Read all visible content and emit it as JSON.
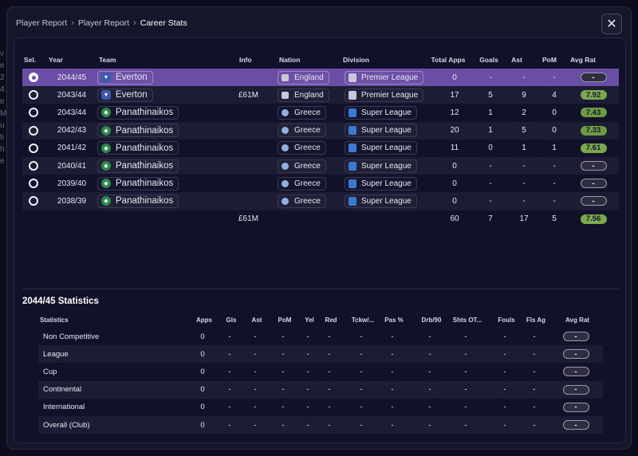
{
  "breadcrumb": [
    "Player Report",
    "Player Report",
    "Career Stats"
  ],
  "close_glyph": "✕",
  "bg_fragment": [
    "v",
    "e",
    "",
    "",
    "",
    "2",
    "4",
    "",
    "e",
    "M",
    "u",
    "ti",
    "h",
    "e"
  ],
  "career": {
    "headers": {
      "sel": "Sel.",
      "year": "Year",
      "team": "Team",
      "info": "Info",
      "nation": "Nation",
      "division": "Division",
      "apps": "Total Apps",
      "goals": "Goals",
      "ast": "Ast",
      "pom": "PoM",
      "avg": "Avg Rat"
    },
    "rows": [
      {
        "selected": true,
        "year": "2044/45",
        "team": "Everton",
        "team_icon": "everton-crest-icon",
        "info": "",
        "nation": "England",
        "nation_icon": "england-flag-icon",
        "division": "Premier League",
        "division_icon": "premier-league-icon",
        "apps": "0",
        "goals": "-",
        "ast": "-",
        "pom": "-",
        "avg": "-"
      },
      {
        "selected": false,
        "year": "2043/44",
        "team": "Everton",
        "team_icon": "everton-crest-icon",
        "info": "£61M",
        "nation": "England",
        "nation_icon": "england-flag-icon",
        "division": "Premier League",
        "division_icon": "premier-league-icon",
        "apps": "17",
        "goals": "5",
        "ast": "9",
        "pom": "4",
        "avg": "7.92"
      },
      {
        "selected": false,
        "year": "2043/44",
        "team": "Panathinaikos",
        "team_icon": "panathinaikos-crest-icon",
        "info": "",
        "nation": "Greece",
        "nation_icon": "greece-flag-icon",
        "division": "Super League",
        "division_icon": "super-league-icon",
        "apps": "12",
        "goals": "1",
        "ast": "2",
        "pom": "0",
        "avg": "7.43"
      },
      {
        "selected": false,
        "year": "2042/43",
        "team": "Panathinaikos",
        "team_icon": "panathinaikos-crest-icon",
        "info": "",
        "nation": "Greece",
        "nation_icon": "greece-flag-icon",
        "division": "Super League",
        "division_icon": "super-league-icon",
        "apps": "20",
        "goals": "1",
        "ast": "5",
        "pom": "0",
        "avg": "7.33"
      },
      {
        "selected": false,
        "year": "2041/42",
        "team": "Panathinaikos",
        "team_icon": "panathinaikos-crest-icon",
        "info": "",
        "nation": "Greece",
        "nation_icon": "greece-flag-icon",
        "division": "Super League",
        "division_icon": "super-league-icon",
        "apps": "11",
        "goals": "0",
        "ast": "1",
        "pom": "1",
        "avg": "7.61"
      },
      {
        "selected": false,
        "year": "2040/41",
        "team": "Panathinaikos",
        "team_icon": "panathinaikos-crest-icon",
        "info": "",
        "nation": "Greece",
        "nation_icon": "greece-flag-icon",
        "division": "Super League",
        "division_icon": "super-league-icon",
        "apps": "0",
        "goals": "-",
        "ast": "-",
        "pom": "-",
        "avg": "-"
      },
      {
        "selected": false,
        "year": "2039/40",
        "team": "Panathinaikos",
        "team_icon": "panathinaikos-crest-icon",
        "info": "",
        "nation": "Greece",
        "nation_icon": "greece-flag-icon",
        "division": "Super League",
        "division_icon": "super-league-icon",
        "apps": "0",
        "goals": "-",
        "ast": "-",
        "pom": "-",
        "avg": "-"
      },
      {
        "selected": false,
        "year": "2038/39",
        "team": "Panathinaikos",
        "team_icon": "panathinaikos-crest-icon",
        "info": "",
        "nation": "Greece",
        "nation_icon": "greece-flag-icon",
        "division": "Super League",
        "division_icon": "super-league-icon",
        "apps": "0",
        "goals": "-",
        "ast": "-",
        "pom": "-",
        "avg": "-"
      }
    ],
    "totals": {
      "info": "£61M",
      "apps": "60",
      "goals": "7",
      "ast": "17",
      "pom": "5",
      "avg": "7.56"
    }
  },
  "statistics": {
    "title": "2044/45 Statistics",
    "headers": [
      "Statistics",
      "Apps",
      "Gls",
      "Ast",
      "PoM",
      "Yel",
      "Red",
      "Tckw/...",
      "Pas %",
      "Drb/90",
      "Shts OT...",
      "Fouls",
      "Fls Ag",
      "Avg Rat"
    ],
    "rows": [
      {
        "label": "Non Competitive",
        "values": [
          "0",
          "-",
          "-",
          "-",
          "-",
          "-",
          "-",
          "-",
          "-",
          "-",
          "-",
          "-",
          "-"
        ]
      },
      {
        "label": "League",
        "values": [
          "0",
          "-",
          "-",
          "-",
          "-",
          "-",
          "-",
          "-",
          "-",
          "-",
          "-",
          "-",
          "-"
        ]
      },
      {
        "label": "Cup",
        "values": [
          "0",
          "-",
          "-",
          "-",
          "-",
          "-",
          "-",
          "-",
          "-",
          "-",
          "-",
          "-",
          "-"
        ]
      },
      {
        "label": "Continental",
        "values": [
          "0",
          "-",
          "-",
          "-",
          "-",
          "-",
          "-",
          "-",
          "-",
          "-",
          "-",
          "-",
          "-"
        ]
      },
      {
        "label": "International",
        "values": [
          "0",
          "-",
          "-",
          "-",
          "-",
          "-",
          "-",
          "-",
          "-",
          "-",
          "-",
          "-",
          "-"
        ]
      },
      {
        "label": "Overall (Club)",
        "values": [
          "0",
          "-",
          "-",
          "-",
          "-",
          "-",
          "-",
          "-",
          "-",
          "-",
          "-",
          "-",
          "-"
        ]
      }
    ]
  },
  "colors": {
    "accent": "#6a4ea6",
    "rating_good": "#7ba84e",
    "background": "#16162b"
  }
}
